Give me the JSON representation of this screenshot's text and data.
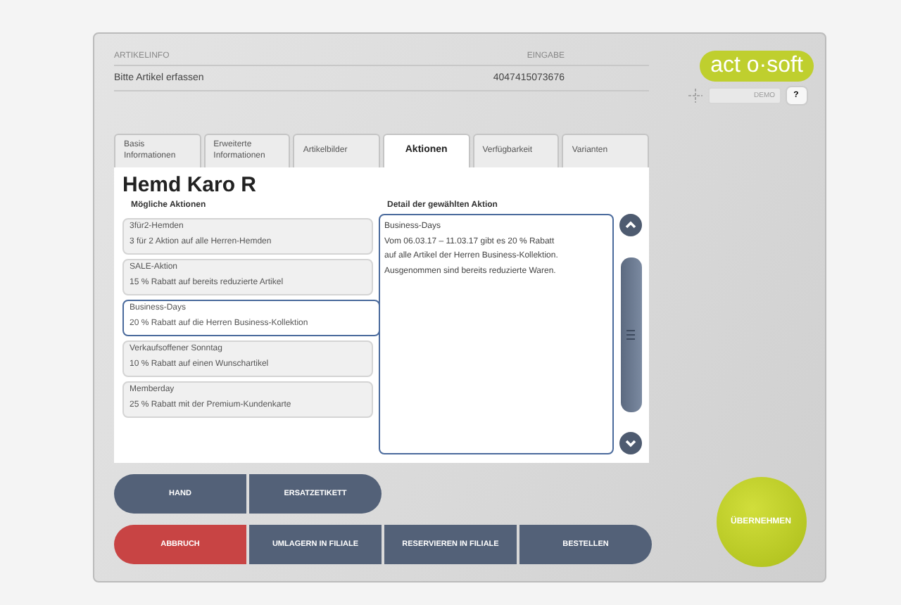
{
  "header": {
    "left_label": "ARTIKELINFO",
    "right_label": "EINGABE",
    "prompt": "Bitte Artikel erfassen",
    "input_value": "4047415073676"
  },
  "logo": {
    "text": "act o·soft"
  },
  "user_field": {
    "value": "DEMO"
  },
  "help_button": {
    "label": "?"
  },
  "tabs": [
    {
      "label": "Basis Informationen",
      "selected": false
    },
    {
      "label": "Erweiterte Informationen",
      "selected": false
    },
    {
      "label": "Artikelbilder",
      "selected": false
    },
    {
      "label": "Aktionen",
      "selected": true
    },
    {
      "label": "Verfügbarkeit",
      "selected": false
    },
    {
      "label": "Varianten",
      "selected": false
    }
  ],
  "article_title": "Hemd Karo R",
  "actions": {
    "heading": "Mögliche Aktionen",
    "items": [
      {
        "title": "3für2-Hemden",
        "description": "3 für 2 Aktion auf alle Herren-Hemden",
        "selected": false
      },
      {
        "title": "SALE-Aktion",
        "description": "15 % Rabatt auf bereits reduzierte Artikel",
        "selected": false
      },
      {
        "title": "Business-Days",
        "description": "20 % Rabatt auf die Herren Business-Kollektion",
        "selected": true
      },
      {
        "title": "Verkaufsoffener Sonntag",
        "description": "10 % Rabatt auf einen Wunschartikel",
        "selected": false
      },
      {
        "title": "Memberday",
        "description": "25 % Rabatt mit der Premium-Kundenkarte",
        "selected": false
      }
    ]
  },
  "detail": {
    "heading": "Detail der gewählten Aktion",
    "lines": [
      "Business-Days",
      "Vom 06.03.17 – 11.03.17 gibt es 20 % Rabatt",
      "auf alle Artikel der Herren Business-Kollektion.",
      "Ausgenommen sind bereits reduzierte Waren."
    ]
  },
  "button_rows": [
    [
      {
        "label": "HAND",
        "kind": "normal"
      },
      {
        "label": "ERSATZETIKETT",
        "kind": "normal"
      }
    ],
    [
      {
        "label": "ABBRUCH",
        "kind": "cancel"
      },
      {
        "label": "UMLAGERN IN FILIALE",
        "kind": "normal"
      },
      {
        "label": "RESERVIEREN IN FILIALE",
        "kind": "normal"
      },
      {
        "label": "BESTELLEN",
        "kind": "normal"
      }
    ]
  ],
  "confirm_button": {
    "label": "ÜBERNEHMEN"
  }
}
